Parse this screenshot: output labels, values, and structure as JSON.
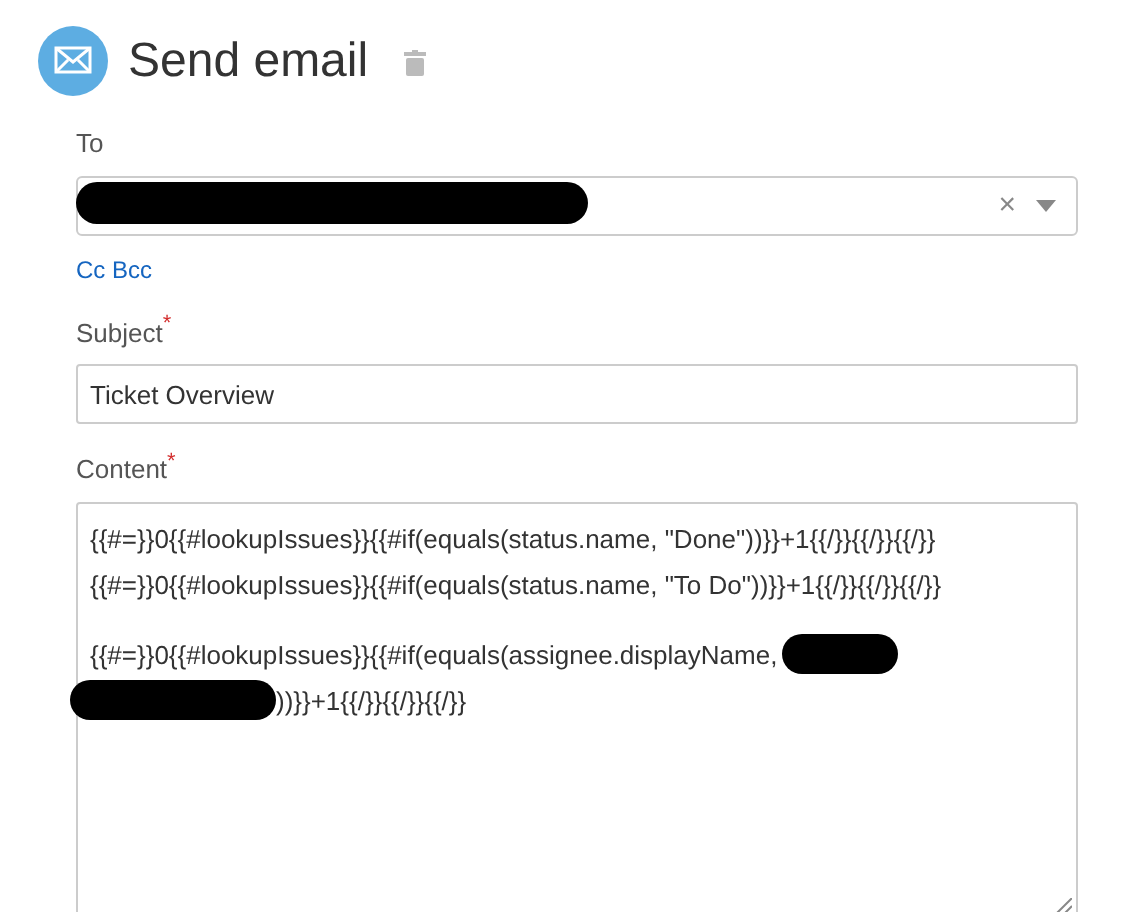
{
  "header": {
    "title": "Send email"
  },
  "to": {
    "label": "To",
    "value": {
      "kind": "redacted"
    },
    "clear": "×"
  },
  "cc_bcc": "Cc Bcc",
  "subject": {
    "label": "Subject",
    "required_mark": "*",
    "value": "Ticket Overview"
  },
  "content": {
    "label": "Content",
    "required_mark": "*",
    "lines": [
      [
        {
          "kind": "text",
          "text": "{{#=}}0{{#lookupIssues}}{{#if(equals(status.name, \"Done\"))}}+1{{/}}{{/}}{{/}}"
        }
      ],
      [
        {
          "kind": "text",
          "text": "{{#=}}0{{#lookupIssues}}{{#if(equals(status.name, \"To Do\"))}}+1{{/}}{{/}}{{/}}"
        }
      ],
      [
        {
          "kind": "blank"
        }
      ],
      [
        {
          "kind": "text",
          "text": "{{#=}}0{{#lookupIssues}}{{#if(equals(assignee.displayName,"
        },
        {
          "kind": "redacted"
        }
      ],
      [
        {
          "kind": "redacted"
        },
        {
          "kind": "text",
          "text": "))}}+1{{/}}{{/}}{{/}}"
        }
      ]
    ]
  }
}
